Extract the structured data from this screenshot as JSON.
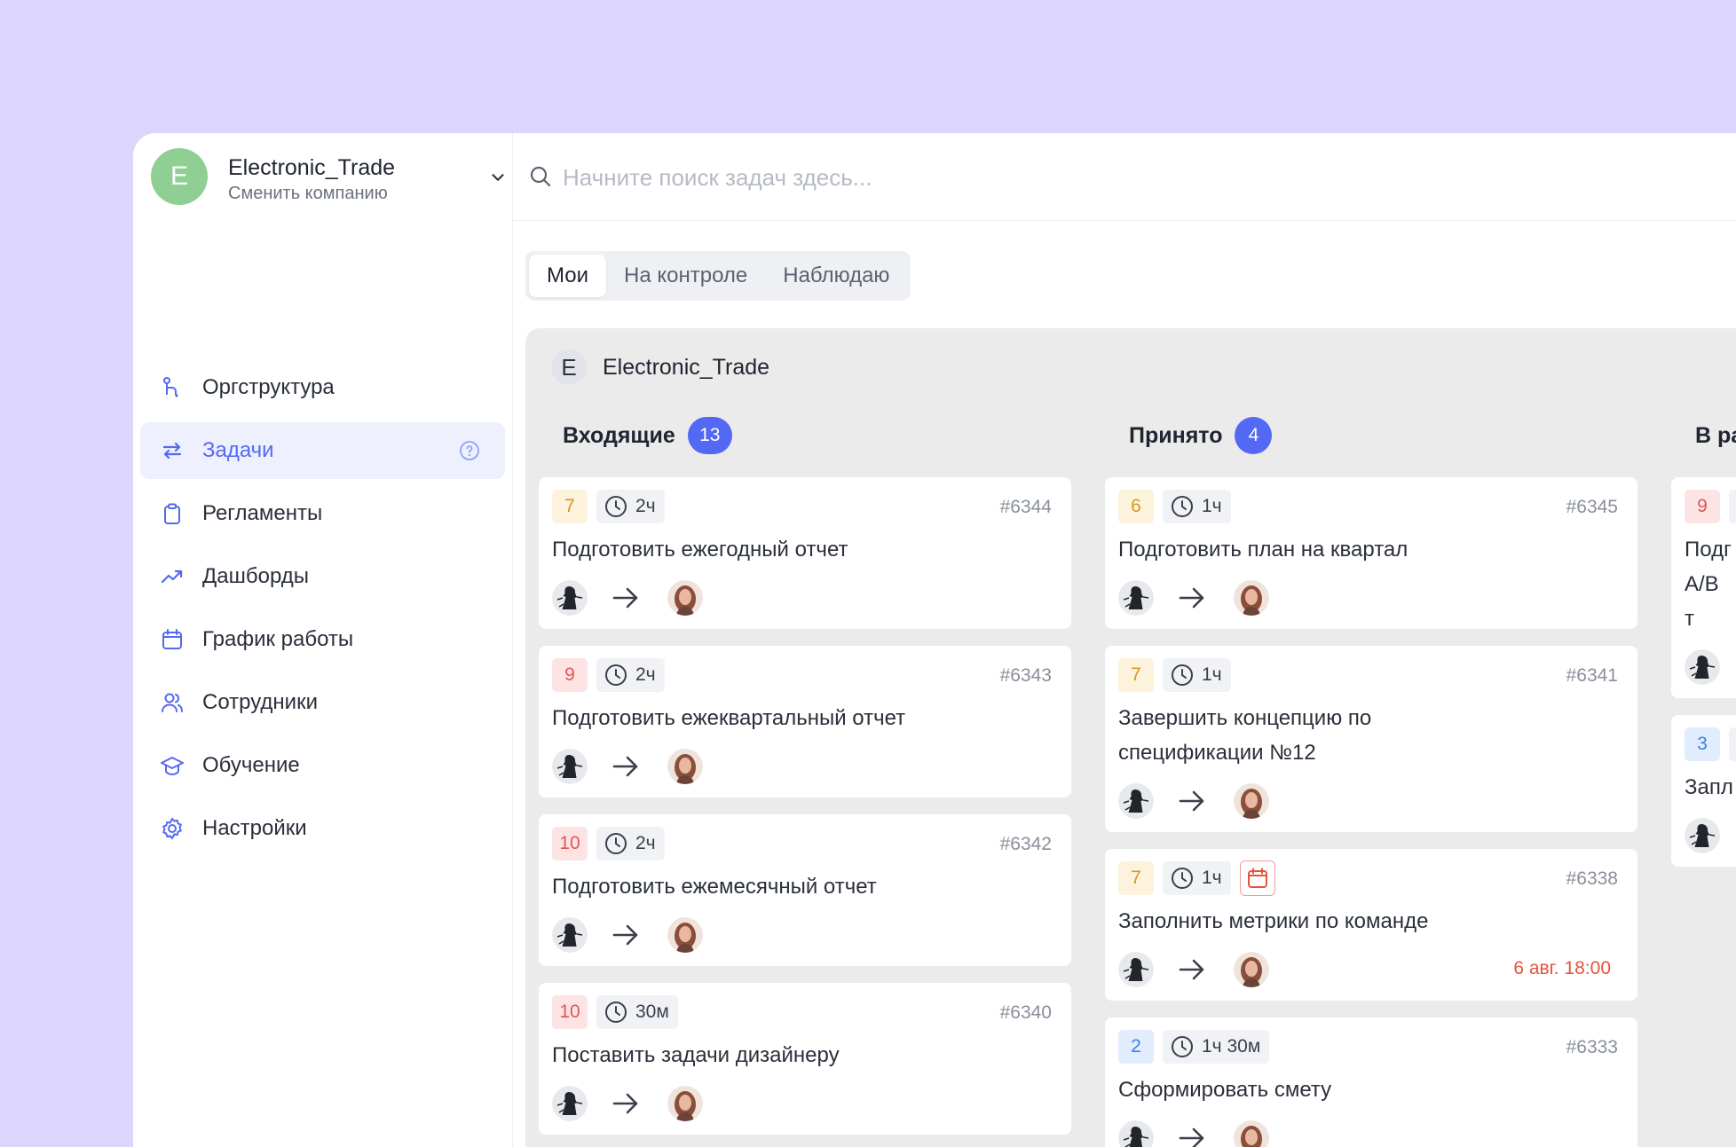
{
  "company": {
    "avatar_letter": "E",
    "name": "Electronic_Trade",
    "switch_label": "Сменить компанию"
  },
  "nav": {
    "items": [
      {
        "label": "Оргструктура",
        "icon": "org-structure-icon"
      },
      {
        "label": "Задачи",
        "icon": "tasks-icon",
        "active": true
      },
      {
        "label": "Регламенты",
        "icon": "clipboard-icon"
      },
      {
        "label": "Дашборды",
        "icon": "trend-chart-icon"
      },
      {
        "label": "График работы",
        "icon": "calendar-icon"
      },
      {
        "label": "Сотрудники",
        "icon": "users-icon"
      },
      {
        "label": "Обучение",
        "icon": "graduation-cap-icon"
      },
      {
        "label": "Настройки",
        "icon": "gear-icon"
      }
    ]
  },
  "search": {
    "placeholder": "Начните поиск задач здесь..."
  },
  "tabs": [
    "Мои",
    "На контроле",
    "Наблюдаю"
  ],
  "board": {
    "avatar_letter": "E",
    "title": "Electronic_Trade"
  },
  "columns": [
    {
      "title": "Входящие",
      "count": "13",
      "cards": [
        {
          "priority": "7",
          "priority_color": "yellow",
          "duration": "2ч",
          "id": "#6344",
          "title": "Подготовить ежегодный отчет"
        },
        {
          "priority": "9",
          "priority_color": "red",
          "duration": "2ч",
          "id": "#6343",
          "title": "Подготовить ежеквартальный отчет"
        },
        {
          "priority": "10",
          "priority_color": "red",
          "duration": "2ч",
          "id": "#6342",
          "title": "Подготовить ежемесячный отчет"
        },
        {
          "priority": "10",
          "priority_color": "red",
          "duration": "30м",
          "id": "#6340",
          "title": "Поставить задачи дизайнеру"
        }
      ]
    },
    {
      "title": "Принято",
      "count": "4",
      "cards": [
        {
          "priority": "6",
          "priority_color": "yellow",
          "duration": "1ч",
          "id": "#6345",
          "title": "Подготовить план на квартал"
        },
        {
          "priority": "7",
          "priority_color": "yellow",
          "duration": "1ч",
          "id": "#6341",
          "title": "Завершить концепцию по спецификации №12"
        },
        {
          "priority": "7",
          "priority_color": "yellow",
          "duration": "1ч",
          "id": "#6338",
          "title": "Заполнить метрики по команде",
          "has_calendar": true,
          "deadline": "6 авг. 18:00"
        },
        {
          "priority": "2",
          "priority_color": "blue",
          "duration": "1ч 30м",
          "id": "#6333",
          "title": "Сформировать смету"
        }
      ]
    },
    {
      "title": "В ра",
      "count": "",
      "cards": [
        {
          "priority": "9",
          "priority_color": "red",
          "duration": "",
          "id": "",
          "title": "Подг A/B т"
        },
        {
          "priority": "3",
          "priority_color": "blue",
          "duration": "",
          "id": "",
          "title": "Запл"
        }
      ]
    }
  ],
  "colors": {
    "background": "#dcd6fd",
    "accent": "#5369f3",
    "board": "#ebebeb",
    "deadline": "#e5533d"
  }
}
